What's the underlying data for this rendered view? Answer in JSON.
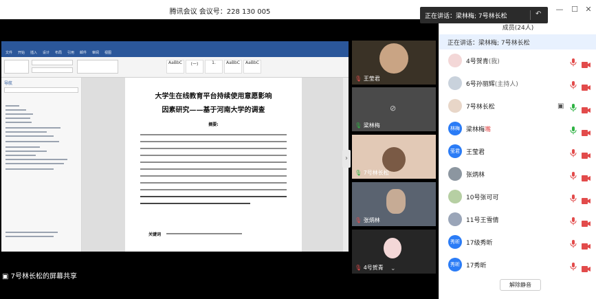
{
  "window": {
    "title": "腾讯会议 会议号：228 130 005"
  },
  "toast": {
    "text": "正在讲话：梁林梅; 7号林长松"
  },
  "share": {
    "label": "7号林长松的屏幕共享"
  },
  "document": {
    "title_line1": "大学生在线教育平台持续使用意愿影响",
    "title_line2": "因素研究——基于河南大学的调查",
    "abstract_label": "摘要:",
    "keywords_label": "关键词",
    "nav_title": "导航",
    "ribbon_tabs": [
      "文件",
      "开始",
      "插入",
      "设计",
      "布局",
      "引用",
      "邮件",
      "审阅",
      "视图"
    ],
    "styles": [
      "AaBbC",
      "(一)",
      "1.",
      "AaBbC",
      "AaBbC"
    ]
  },
  "video_tiles": [
    {
      "name": "王莹君",
      "muted": true
    },
    {
      "name": "梁林梅",
      "muted": false
    },
    {
      "name": "7号林长松",
      "muted": false
    },
    {
      "name": "张炳林",
      "muted": true
    },
    {
      "name": "4号贺青",
      "muted": true
    }
  ],
  "panel": {
    "header": "成员(24人)",
    "current_speaker": "正在讲话：梁林梅; 7号林长松",
    "members": [
      {
        "name": "4号贺青",
        "role": "(我)",
        "avatar_text": "",
        "avatar_color": "#f3d7d7",
        "mic": "muted"
      },
      {
        "name": "6号孙丽辉",
        "role": "(主持人)",
        "avatar_text": "",
        "avatar_color": "#c9d2dc",
        "mic": "muted"
      },
      {
        "name": "7号林长松",
        "role": "",
        "avatar_text": "",
        "avatar_color": "#e8d6c8",
        "mic": "on"
      },
      {
        "name": "梁林梅",
        "role": "嘴",
        "avatar_text": "林梅",
        "avatar_color": "#2b7cf6",
        "mic": "on"
      },
      {
        "name": "王莹君",
        "role": "",
        "avatar_text": "莹君",
        "avatar_color": "#2b7cf6",
        "mic": "muted"
      },
      {
        "name": "张炳林",
        "role": "",
        "avatar_text": "",
        "avatar_color": "#8c96a0",
        "mic": "muted"
      },
      {
        "name": "10号张可可",
        "role": "",
        "avatar_text": "",
        "avatar_color": "#b6cfa3",
        "mic": "muted"
      },
      {
        "name": "11号王雪倩",
        "role": "",
        "avatar_text": "",
        "avatar_color": "#9aa5b8",
        "mic": "muted"
      },
      {
        "name": "17级秀昕",
        "role": "",
        "avatar_text": "秀昕",
        "avatar_color": "#2b7cf6",
        "mic": "muted"
      },
      {
        "name": "17秀昕",
        "role": "",
        "avatar_text": "秀昕",
        "avatar_color": "#2b7cf6",
        "mic": "muted"
      }
    ],
    "unmute_all_label": "解除静音"
  },
  "colors": {
    "accent": "#2b7cf6",
    "mic_muted": "#e24b4b",
    "mic_on": "#2fb344",
    "word_blue": "#2b579a"
  }
}
